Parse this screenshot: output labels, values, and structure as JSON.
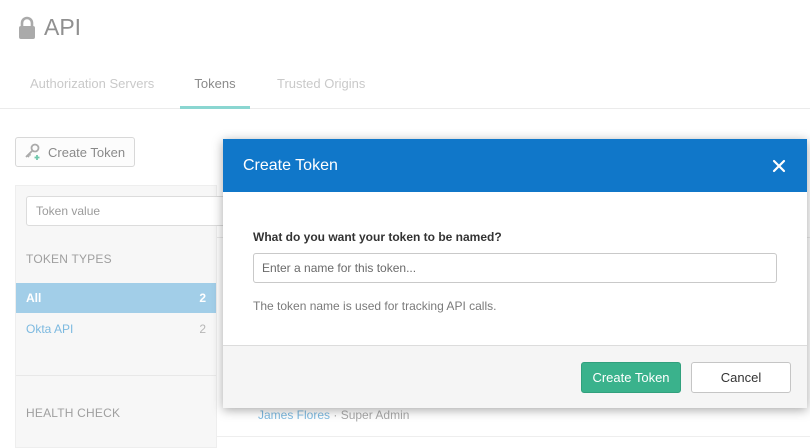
{
  "page": {
    "title": "API"
  },
  "tabs": [
    {
      "label": "Authorization Servers",
      "active": false
    },
    {
      "label": "Tokens",
      "active": true
    },
    {
      "label": "Trusted Origins",
      "active": false
    }
  ],
  "toolbar": {
    "create_label": "Create Token"
  },
  "sidebar": {
    "search_placeholder": "Token value",
    "token_types_label": "TOKEN TYPES",
    "filters": [
      {
        "label": "All",
        "count": "2",
        "active": true
      },
      {
        "label": "Okta API",
        "count": "2",
        "active": false
      }
    ],
    "health_check_label": "HEALTH CHECK"
  },
  "background_row": {
    "user": "James Flores",
    "separator": " · ",
    "role": "Super Admin"
  },
  "modal": {
    "title": "Create Token",
    "field_label": "What do you want your token to be named?",
    "input_placeholder": "Enter a name for this token...",
    "input_value": "",
    "help_text": "The token name is used for tracking API calls.",
    "primary_label": "Create Token",
    "cancel_label": "Cancel"
  },
  "colors": {
    "modal_header": "#1077c9",
    "primary_button": "#3ab28c",
    "active_tab_underline": "#5ec7c0",
    "active_filter": "#7fbbe0",
    "link": "#4a9fd4"
  }
}
